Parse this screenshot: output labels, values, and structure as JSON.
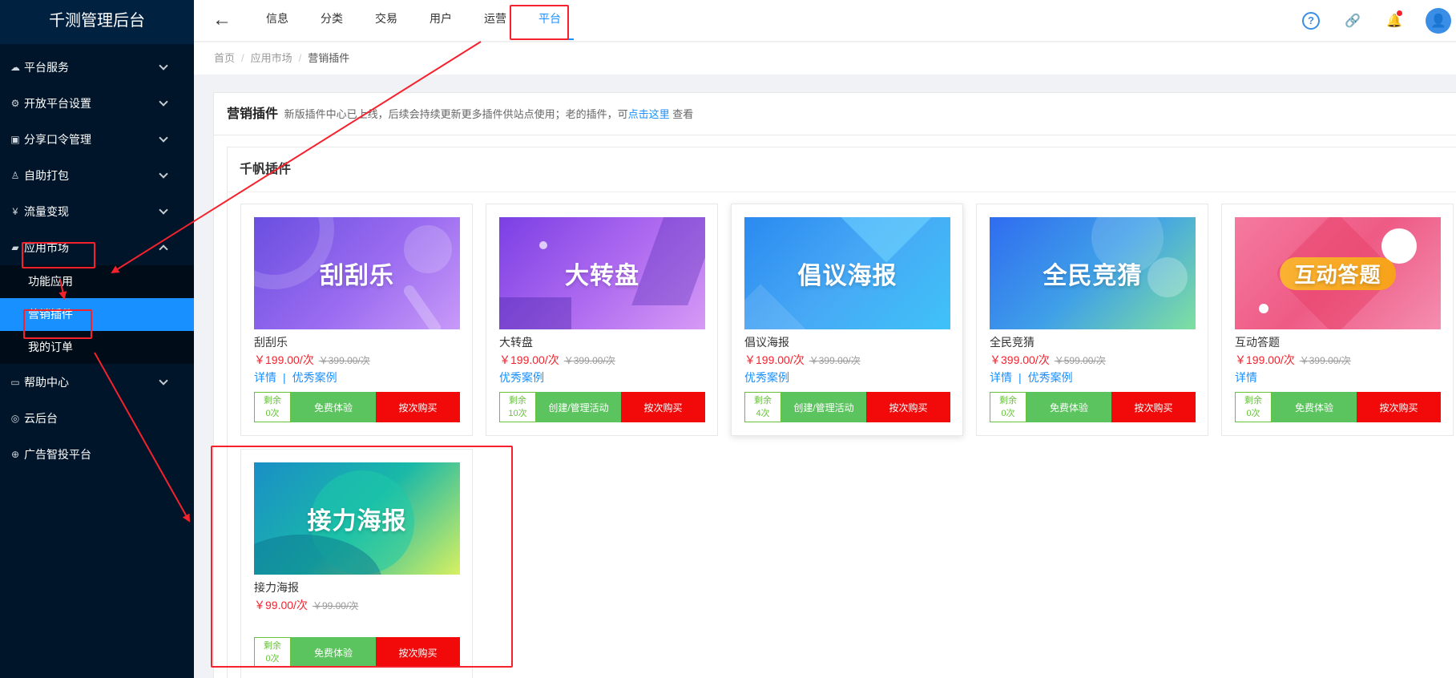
{
  "app": {
    "title": "千测管理后台"
  },
  "sidebar": {
    "items": [
      {
        "label": "平台服务",
        "icon": "cloud-icon",
        "glyph": "☁",
        "expanded": false
      },
      {
        "label": "开放平台设置",
        "icon": "gear-icon",
        "glyph": "⚙",
        "expanded": false
      },
      {
        "label": "分享口令管理",
        "icon": "clipboard-icon",
        "glyph": "▣",
        "expanded": false
      },
      {
        "label": "自助打包",
        "icon": "user-icon",
        "glyph": "♙",
        "expanded": false
      },
      {
        "label": "流量变现",
        "icon": "yen-icon",
        "glyph": "¥",
        "expanded": false
      },
      {
        "label": "应用市场",
        "icon": "shop-bag-icon",
        "glyph": "▰",
        "expanded": true
      },
      {
        "label": "帮助中心",
        "icon": "folder-icon",
        "glyph": "▭",
        "expanded": false
      },
      {
        "label": "云后台",
        "icon": "cloud-console-icon",
        "glyph": "◎"
      },
      {
        "label": "广告智投平台",
        "icon": "ad-platform-icon",
        "glyph": "⊕"
      }
    ],
    "submenu": [
      {
        "label": "功能应用",
        "active": false
      },
      {
        "label": "营销插件",
        "active": true
      },
      {
        "label": "我的订单",
        "active": false
      }
    ]
  },
  "header": {
    "back_glyph": "←",
    "tabs": [
      {
        "label": "信息",
        "active": false
      },
      {
        "label": "分类",
        "active": false
      },
      {
        "label": "交易",
        "active": false
      },
      {
        "label": "用户",
        "active": false
      },
      {
        "label": "运营",
        "active": false
      },
      {
        "label": "平台",
        "active": true
      }
    ],
    "help_glyph": "?",
    "link_glyph": "🔗",
    "bell_glyph": "🔔",
    "avatar_glyph": "👤"
  },
  "breadcrumb": {
    "home": "首页",
    "market": "应用市场",
    "current": "营销插件",
    "sep": "/"
  },
  "page": {
    "title": "营销插件",
    "notice_before": "新版插件中心已上线，后续会持续更新更多插件供站点使用；老的插件，可",
    "notice_link": "点击这里",
    "notice_after": "查看",
    "section_title": "千帆插件"
  },
  "plugins": [
    {
      "name": "刮刮乐",
      "banner_text": "刮刮乐",
      "price": "￥199.00/次",
      "orig_price": "￥399.00/次",
      "link1": "详情",
      "link_sep": "|",
      "link2": "优秀案例",
      "remain_label": "剩余",
      "remain_count": "0次",
      "primary_btn": "免费体验",
      "buy_btn": "按次购买"
    },
    {
      "name": "大转盘",
      "banner_text": "大转盘",
      "price": "￥199.00/次",
      "orig_price": "￥399.00/次",
      "link1": "",
      "link_sep": "",
      "link2": "优秀案例",
      "remain_label": "剩余",
      "remain_count": "10次",
      "primary_btn": "创建/管理活动",
      "buy_btn": "按次购买"
    },
    {
      "name": "倡议海报",
      "banner_text": "倡议海报",
      "price": "￥199.00/次",
      "orig_price": "￥399.00/次",
      "link1": "",
      "link_sep": "",
      "link2": "优秀案例",
      "remain_label": "剩余",
      "remain_count": "4次",
      "primary_btn": "创建/管理活动",
      "buy_btn": "按次购买"
    },
    {
      "name": "全民竞猜",
      "banner_text": "全民竞猜",
      "price": "￥399.00/次",
      "orig_price": "￥599.00/次",
      "link1": "详情",
      "link_sep": "|",
      "link2": "优秀案例",
      "remain_label": "剩余",
      "remain_count": "0次",
      "primary_btn": "免费体验",
      "buy_btn": "按次购买"
    },
    {
      "name": "互动答题",
      "banner_text": "互动答题",
      "price": "￥199.00/次",
      "orig_price": "￥399.00/次",
      "link1": "详情",
      "link_sep": "",
      "link2": "",
      "remain_label": "剩余",
      "remain_count": "0次",
      "primary_btn": "免费体验",
      "buy_btn": "按次购买"
    },
    {
      "name": "接力海报",
      "banner_text": "接力海报",
      "price": "￥99.00/次",
      "orig_price": "￥99.00/次",
      "link1": "",
      "link_sep": "",
      "link2": "",
      "remain_label": "剩余",
      "remain_count": "0次",
      "primary_btn": "免费体验",
      "buy_btn": "按次购买"
    }
  ],
  "colors": {
    "accent": "#1890ff",
    "sidebar_bg": "#001529",
    "price_red": "#f5222d",
    "buy_red": "#f20a0a",
    "trial_green": "#5cc45e",
    "annotation_red": "#f5222d"
  }
}
